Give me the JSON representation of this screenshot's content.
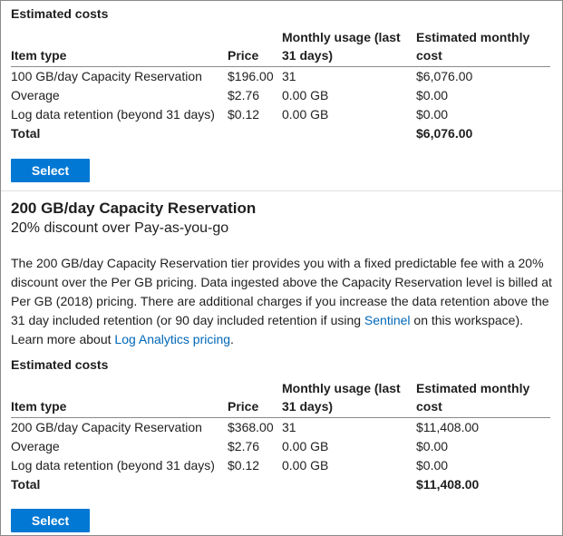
{
  "section1": {
    "estimated_costs_title": "Estimated costs",
    "headers": {
      "item_type": "Item type",
      "price": "Price",
      "usage_line1": "Monthly usage (last",
      "usage_line2": "31 days)",
      "estimated_line1": "Estimated monthly",
      "estimated_line2": "cost"
    },
    "rows": [
      {
        "item": "100 GB/day Capacity Reservation",
        "price": "$196.00",
        "usage": "31",
        "cost": "$6,076.00"
      },
      {
        "item": "Overage",
        "price": "$2.76",
        "usage": "0.00 GB",
        "cost": "$0.00"
      },
      {
        "item": "Log data retention (beyond 31 days)",
        "price": "$0.12",
        "usage": "0.00 GB",
        "cost": "$0.00"
      }
    ],
    "total_label": "Total",
    "total_value": "$6,076.00",
    "select_label": "Select"
  },
  "section2": {
    "title": "200 GB/day Capacity Reservation",
    "subtitle": "20% discount over Pay-as-you-go",
    "description_part1": "The 200 GB/day Capacity Reservation tier provides you with a fixed predictable fee with a 20% discount over the Per GB pricing. Data ingested above the Capacity Reservation level is billed at Per GB (2018) pricing. There are additional charges if you increase the data retention above the 31 day included retention (or 90 day included retention if using ",
    "sentinel_link": "Sentinel",
    "description_part2": " on this workspace). Learn more about ",
    "pricing_link": "Log Analytics pricing",
    "description_end": ".",
    "estimated_costs_title": "Estimated costs",
    "headers": {
      "item_type": "Item type",
      "price": "Price",
      "usage_line1": "Monthly usage (last",
      "usage_line2": "31 days)",
      "estimated_line1": "Estimated monthly",
      "estimated_line2": "cost"
    },
    "rows": [
      {
        "item": "200 GB/day Capacity Reservation",
        "price": "$368.00",
        "usage": "31",
        "cost": "$11,408.00"
      },
      {
        "item": "Overage",
        "price": "$2.76",
        "usage": "0.00 GB",
        "cost": "$0.00"
      },
      {
        "item": "Log data retention (beyond 31 days)",
        "price": "$0.12",
        "usage": "0.00 GB",
        "cost": "$0.00"
      }
    ],
    "total_label": "Total",
    "total_value": "$11,408.00",
    "select_label": "Select"
  },
  "colors": {
    "accent": "#0078d4",
    "link": "#0067b8"
  }
}
